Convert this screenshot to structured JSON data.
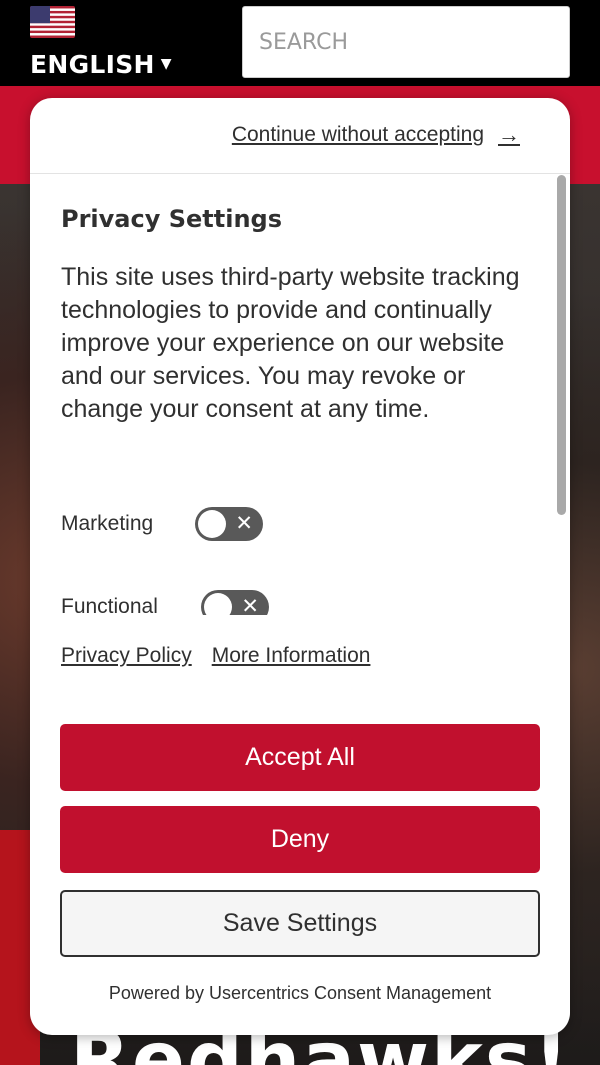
{
  "header": {
    "language_label": "ENGLISH",
    "language_caret": "▼",
    "search_placeholder": "SEARCH"
  },
  "hero": {
    "title": "Redhawks!"
  },
  "consent": {
    "continue_label": "Continue without accepting",
    "continue_arrow": "→",
    "title": "Privacy Settings",
    "description": "This site uses third-party website tracking technologies to provide and continually improve your experience on our website and our services. You may revoke or change your consent at any time.",
    "categories": [
      {
        "label": "Marketing",
        "enabled": false,
        "icon": "close-icon"
      },
      {
        "label": "Functional",
        "enabled": false,
        "icon": "close-icon"
      }
    ],
    "privacy_policy_label": "Privacy Policy",
    "more_info_label": "More Information",
    "accept_label": "Accept All",
    "deny_label": "Deny",
    "save_label": "Save Settings",
    "powered_by": "Powered by Usercentrics Consent Management"
  },
  "colors": {
    "brand_red": "#c1102e",
    "toggle_off": "#595959",
    "text": "#303030"
  }
}
